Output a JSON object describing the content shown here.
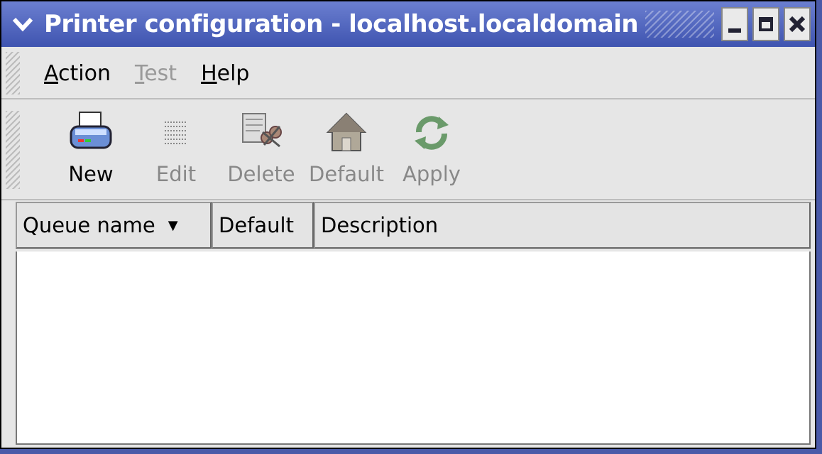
{
  "window": {
    "title": "Printer configuration - localhost.localdomain",
    "menu_icon": "chevron-down-icon",
    "controls": [
      "minimize",
      "maximize",
      "close"
    ]
  },
  "menubar": {
    "items": [
      {
        "mnemonic": "A",
        "rest": "ction",
        "enabled": true
      },
      {
        "mnemonic": "T",
        "rest": "est",
        "enabled": false
      },
      {
        "mnemonic": "H",
        "rest": "elp",
        "enabled": true
      }
    ]
  },
  "toolbar": {
    "items": [
      {
        "label": "New",
        "icon": "printer-icon",
        "enabled": true
      },
      {
        "label": "Edit",
        "icon": "edit-icon",
        "enabled": false
      },
      {
        "label": "Delete",
        "icon": "delete-icon",
        "enabled": false
      },
      {
        "label": "Default",
        "icon": "home-icon",
        "enabled": false
      },
      {
        "label": "Apply",
        "icon": "apply-icon",
        "enabled": false
      }
    ]
  },
  "table": {
    "columns": [
      "Queue name",
      "Default",
      "Description"
    ],
    "sort_indicator": "▼",
    "rows": []
  }
}
